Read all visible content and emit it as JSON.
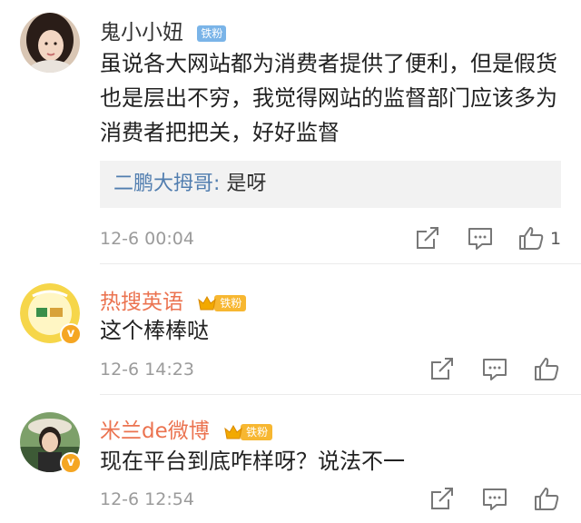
{
  "comments": [
    {
      "username": "鬼小小妞",
      "badge": "铁粉",
      "text": "虽说各大网站都为消费者提供了便利，但是假货也是层出不穷，我觉得网站的监督部门应该多为消费者把把关，好好监督",
      "reply": {
        "name": "二鹏大拇哥",
        "separator": ": ",
        "text": "是呀"
      },
      "time": "12-6 00:04",
      "likes": "1"
    },
    {
      "username": "热搜英语",
      "badge": "铁粉",
      "text": "这个棒棒哒",
      "time": "12-6 14:23"
    },
    {
      "username": "米兰de微博",
      "badge": "铁粉",
      "text": "现在平台到底咋样呀？说法不一",
      "time": "12-6 12:54"
    }
  ],
  "icons": {
    "share": "share-icon",
    "comment": "comment-icon",
    "like": "thumbs-up-icon",
    "verified": "verified-v-icon"
  },
  "colors": {
    "name_orange": "#eb7350",
    "reply_name": "#507daf",
    "badge_blue": "#7ab4e8",
    "badge_gold": "#f7b731",
    "time_gray": "#9b9b9b"
  }
}
